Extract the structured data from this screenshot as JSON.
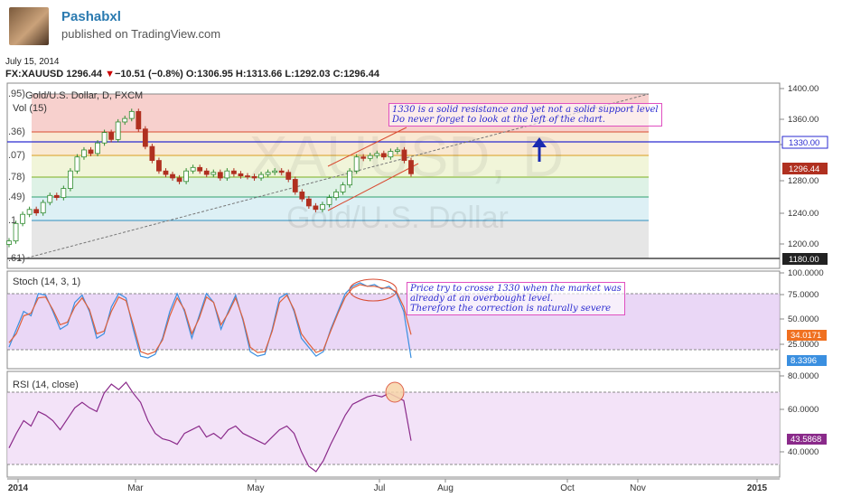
{
  "header": {
    "author": "Pashabxl",
    "published": "published on TradingView.com",
    "date": "July 15, 2014",
    "symbol": "FX:XAUUSD",
    "last": "1296.44",
    "change": "−10.51 (−0.8%)",
    "o_label": "O:",
    "o": "1306.95",
    "h_label": "H:",
    "h": "1313.66",
    "l_label": "L:",
    "l": "1292.03",
    "c_label": "C:",
    "c": "1296.44"
  },
  "main": {
    "title": "Gold/U.S. Dollar, D, FXCM",
    "vol": "Vol (15)",
    "watermark_symbol": "XAUUSD, D",
    "watermark_name": "Gold/U.S. Dollar",
    "fib_labels": [
      ".95)",
      ".36)",
      ".07)",
      ".78)",
      ".49)",
      ".1",
      ".61)"
    ],
    "y_ticks": [
      "1400.00",
      "1360.00",
      "1320.00",
      "1280.00",
      "1240.00",
      "1200.00"
    ],
    "resistance_tag": "1330.00",
    "price_tag": "1296.44",
    "support_tag": "1180.00",
    "note": "1330 is a solid resistance and yet not a solid support level\nDo never forget to look at the left of the chart."
  },
  "stoch": {
    "title": "Stoch (14, 3, 1)",
    "y_ticks": [
      "100.0000",
      "75.0000",
      "50.0000",
      "25.0000"
    ],
    "k_tag": "34.0171",
    "d_tag": "8.3396",
    "note": "Price try to crosse 1330 when the market was\nalready at an overbought level.\nTherefore the correction is naturally severe"
  },
  "rsi": {
    "title": "RSI (14, close)",
    "y_ticks": [
      "80.0000",
      "60.0000",
      "40.0000"
    ],
    "tag": "43.5868"
  },
  "x_axis": {
    "labels": [
      "2014",
      "Mar",
      "May",
      "Jul",
      "Aug",
      "Oct",
      "Nov",
      "2015"
    ]
  },
  "colors": {
    "up": "#2e8b2e",
    "down": "#b03020",
    "blue_line": "#2a2ad0",
    "stoch_k": "#3a8fe0",
    "stoch_d": "#e0603a",
    "rsi": "#8a2a8a",
    "note_border": "#e050c0"
  },
  "chart_data": [
    {
      "type": "candlestick",
      "title": "Gold/U.S. Dollar, D, FXCM",
      "ylim": [
        1175,
        1410
      ],
      "x": [
        "2014",
        "Mar",
        "May",
        "Jul",
        "Aug",
        "Oct",
        "Nov",
        "2015"
      ],
      "close_series": [
        1200,
        1225,
        1238,
        1245,
        1240,
        1255,
        1265,
        1262,
        1275,
        1300,
        1320,
        1330,
        1325,
        1340,
        1355,
        1345,
        1370,
        1375,
        1385,
        1360,
        1335,
        1315,
        1300,
        1295,
        1290,
        1285,
        1300,
        1305,
        1300,
        1295,
        1298,
        1290,
        1300,
        1296,
        1293,
        1292,
        1290,
        1295,
        1298,
        1300,
        1298,
        1288,
        1270,
        1260,
        1250,
        1245,
        1252,
        1262,
        1270,
        1280,
        1300,
        1320,
        1318,
        1322,
        1325,
        1320,
        1328,
        1330,
        1315,
        1296
      ],
      "levels": [
        {
          "value": 1330,
          "label": "1330.00"
        },
        {
          "value": 1180,
          "label": "1180.00"
        }
      ],
      "last": 1296.44
    },
    {
      "type": "line",
      "title": "Stoch (14, 3, 1)",
      "ylim": [
        0,
        105
      ],
      "series": [
        {
          "name": "K",
          "values": [
            20,
            40,
            60,
            55,
            80,
            78,
            60,
            40,
            45,
            70,
            78,
            60,
            30,
            35,
            65,
            80,
            75,
            40,
            10,
            8,
            12,
            30,
            60,
            80,
            60,
            30,
            55,
            80,
            70,
            40,
            60,
            78,
            50,
            15,
            10,
            12,
            40,
            75,
            80,
            60,
            30,
            20,
            10,
            15,
            40,
            60,
            80,
            88,
            92,
            88,
            90,
            85,
            88,
            80,
            60,
            8
          ]
        },
        {
          "name": "D",
          "values": [
            25,
            35,
            55,
            58,
            75,
            76,
            62,
            45,
            48,
            65,
            75,
            62,
            35,
            38,
            60,
            76,
            72,
            45,
            15,
            12,
            15,
            28,
            55,
            75,
            62,
            35,
            52,
            76,
            70,
            45,
            58,
            75,
            52,
            20,
            14,
            15,
            38,
            70,
            78,
            62,
            35,
            24,
            14,
            17,
            38,
            58,
            76,
            86,
            90,
            88,
            88,
            86,
            86,
            82,
            65,
            34
          ]
        }
      ],
      "levels": [
        80,
        20
      ],
      "last_k": 34.0171,
      "last_d": 8.3396
    },
    {
      "type": "line",
      "title": "RSI (14, close)",
      "ylim": [
        24,
        82
      ],
      "series": [
        {
          "name": "RSI",
          "values": [
            40,
            48,
            55,
            52,
            60,
            58,
            55,
            50,
            56,
            62,
            65,
            62,
            60,
            70,
            75,
            72,
            76,
            70,
            65,
            55,
            48,
            45,
            44,
            42,
            48,
            50,
            52,
            46,
            48,
            45,
            50,
            52,
            48,
            46,
            44,
            42,
            46,
            50,
            52,
            48,
            38,
            30,
            27,
            33,
            42,
            50,
            58,
            64,
            66,
            68,
            69,
            68,
            70,
            68,
            66,
            44
          ]
        }
      ],
      "levels": [
        70,
        30
      ],
      "last": 43.5868
    }
  ]
}
